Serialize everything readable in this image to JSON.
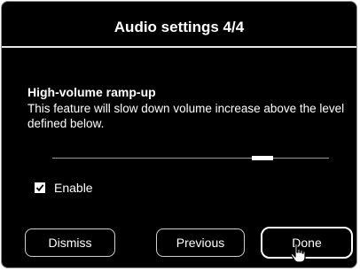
{
  "dialog": {
    "title": "Audio settings 4/4",
    "heading": "High-volume ramp-up",
    "description": "This feature will slow down volume increase above the level defined below.",
    "slider": {
      "value_fraction": 0.76
    },
    "enable": {
      "label": "Enable",
      "checked": true
    }
  },
  "buttons": {
    "dismiss": "Dismiss",
    "previous": "Previous",
    "done": "Done"
  },
  "icons": {
    "checkbox": "checkmark-icon",
    "cursor": "hand-pointer-icon"
  },
  "colors": {
    "background": "#000000",
    "text": "#ffffff",
    "border": "#cfcfcf"
  }
}
